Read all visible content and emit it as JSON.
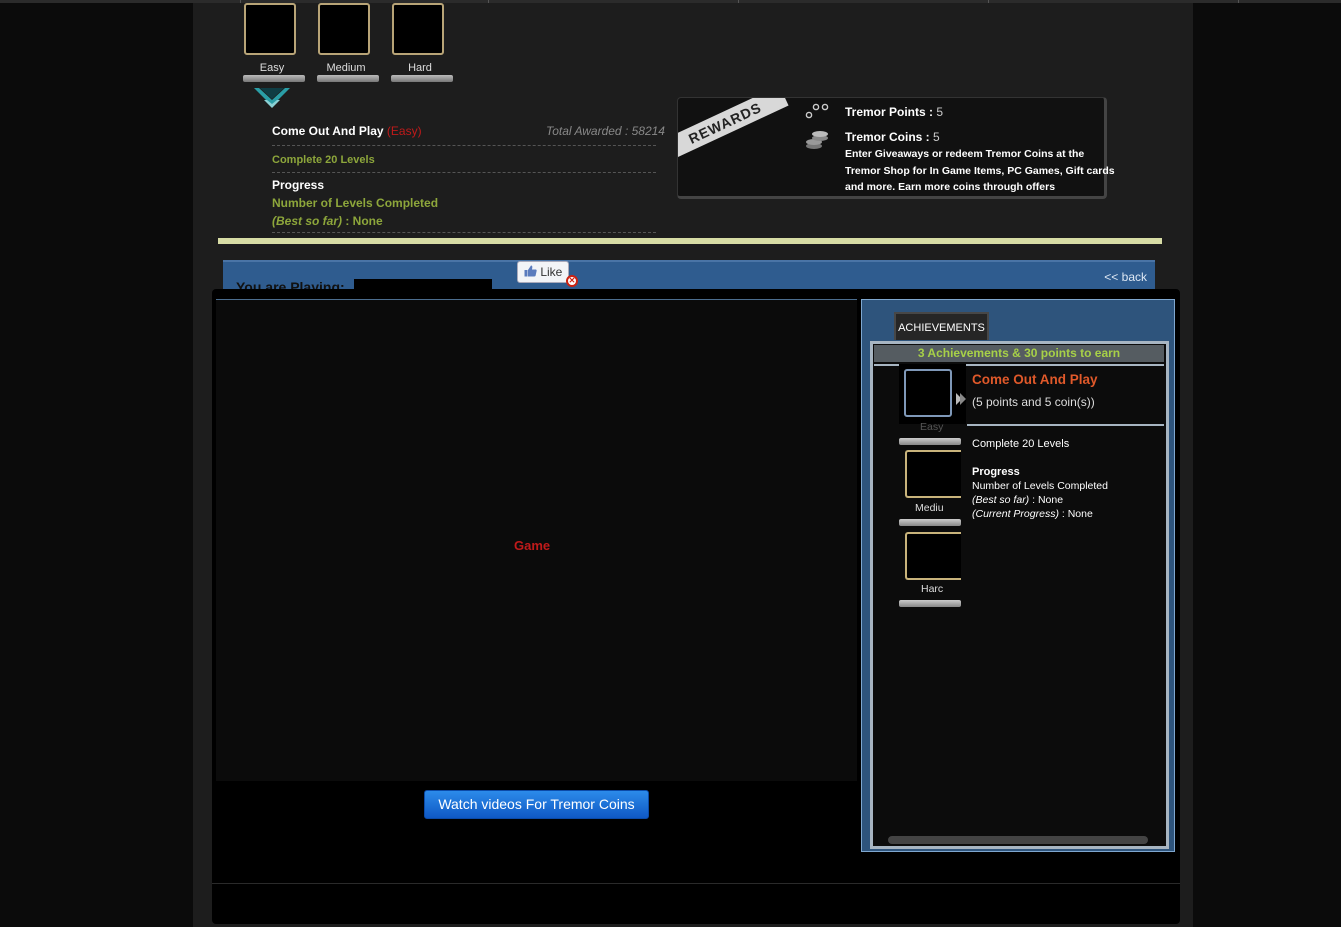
{
  "tiers": [
    {
      "label": "Easy"
    },
    {
      "label": "Medium"
    },
    {
      "label": "Hard"
    }
  ],
  "achievement_summary": {
    "title": "Come Out And Play",
    "difficulty": "(Easy)",
    "total_awarded": "Total Awarded : 58214",
    "requirement": "Complete 20 Levels",
    "progress_heading": "Progress",
    "progress_metric": "Number of Levels Completed",
    "best_label": "(Best so far)",
    "best_value": " : None"
  },
  "rewards": {
    "ribbon": "REWARDS",
    "points_label": "Tremor Points : ",
    "points_value": "5",
    "coins_label": "Tremor Coins : ",
    "coins_value": "5",
    "description": "Enter Giveaways or redeem Tremor Coins at the Tremor Shop for In Game Items, PC Games, Gift cards and more. Earn more coins through offers"
  },
  "play_bar": {
    "label": "You are Playing:",
    "back": "<< back",
    "like": "Like"
  },
  "game": {
    "placeholder": "Game",
    "watch_button": "Watch videos For Tremor Coins"
  },
  "achievements": {
    "tab": "ACHIEVEMENTS",
    "header": "3 Achievements & 30 points to earn",
    "icons": [
      {
        "label": "Easy"
      },
      {
        "label": "Mediu"
      },
      {
        "label": "Harc"
      }
    ],
    "detail": {
      "name": "Come Out And Play",
      "points": "(5 points and 5 coin(s))",
      "requirement": "Complete 20 Levels",
      "progress_heading": "Progress",
      "metric": "Number of Levels Completed",
      "best_label": "(Best so far)",
      "best_value": " : None",
      "current_label": "(Current Progress)",
      "current_value": " : None"
    }
  },
  "colors": {
    "accent_blue": "#2f5c8f",
    "achievement_green": "#a7d048",
    "achievement_orange": "#e0592a",
    "game_red": "#c01a1a"
  }
}
